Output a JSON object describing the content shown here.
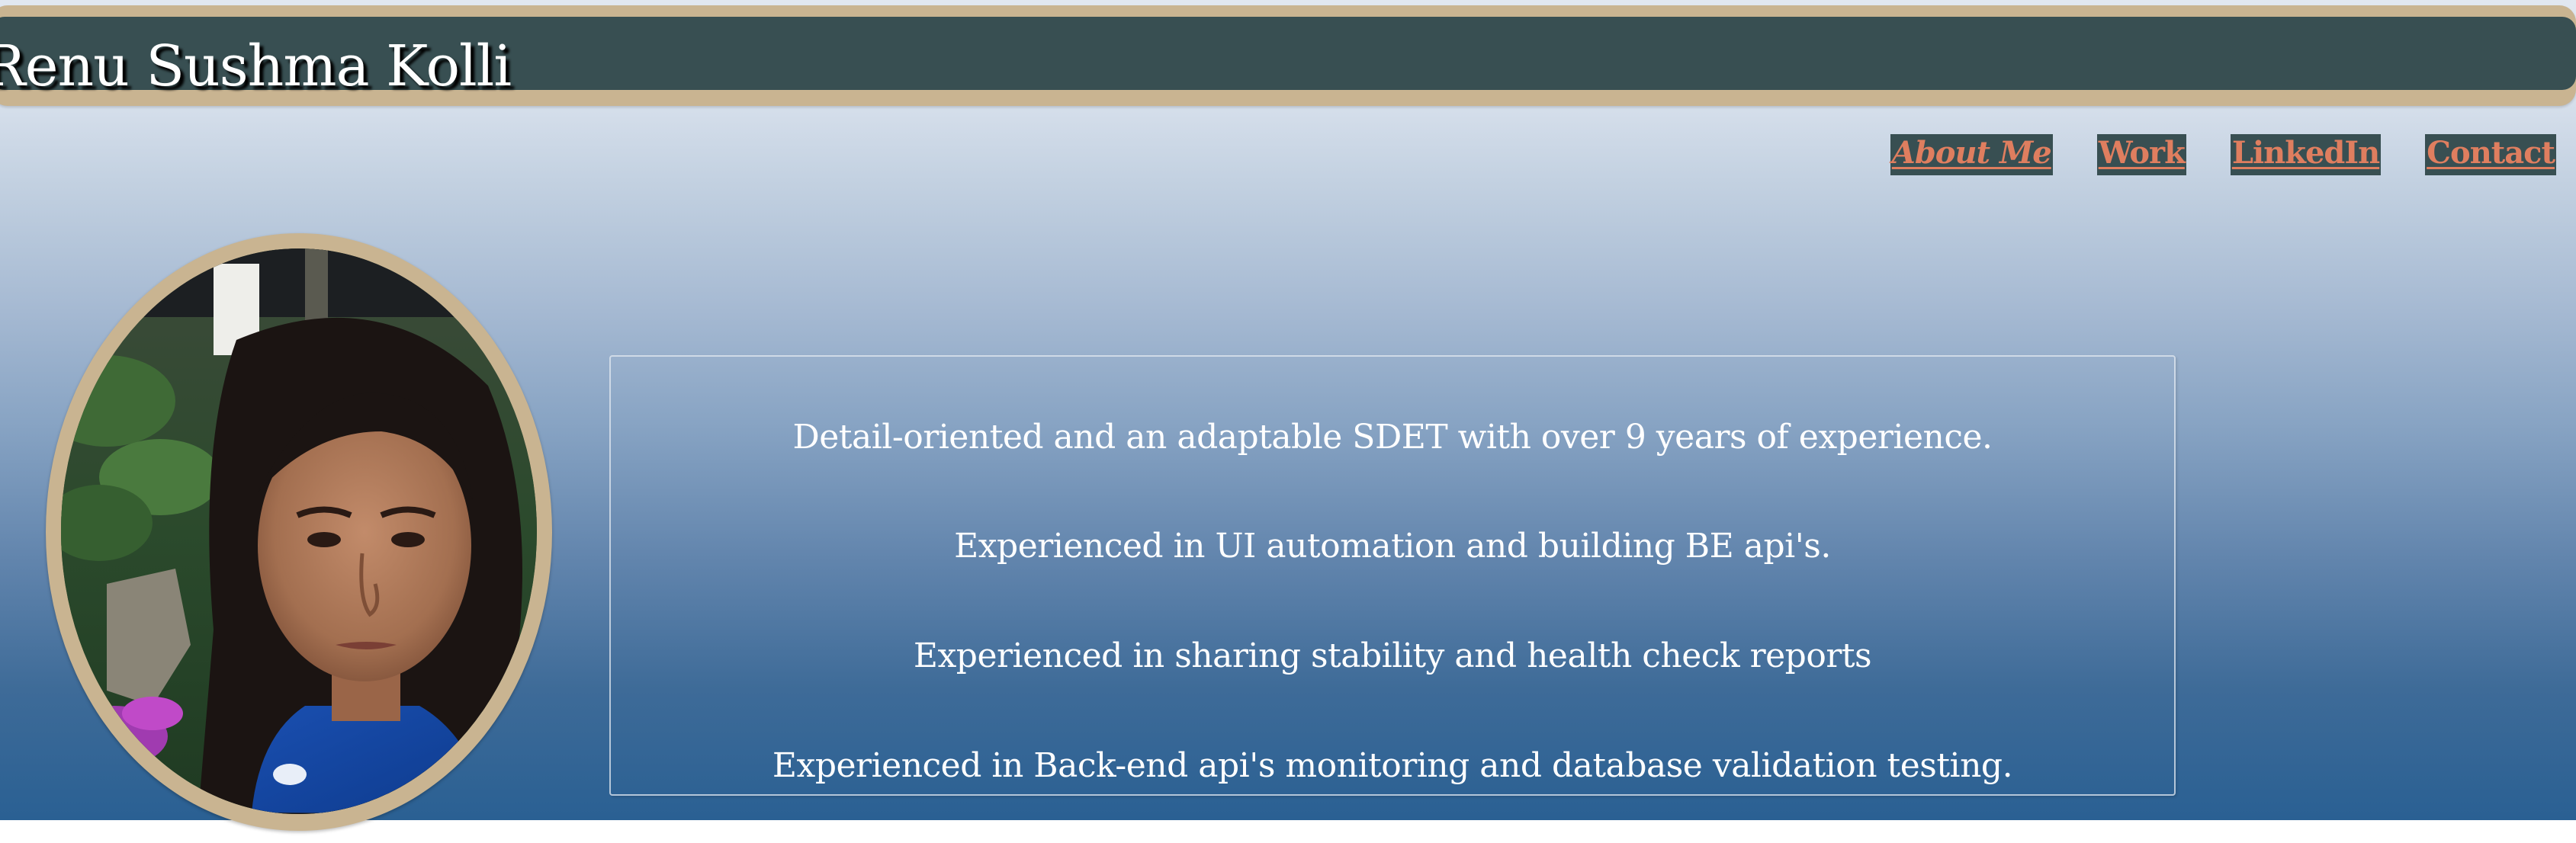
{
  "header": {
    "title": "Renu Sushma Kolli"
  },
  "nav": {
    "items": [
      {
        "label": "About Me",
        "style": "italic"
      },
      {
        "label": "Work"
      },
      {
        "label": "LinkedIn"
      },
      {
        "label": "Contact"
      }
    ]
  },
  "profile": {
    "photo_icon": "profile-photo"
  },
  "bio": {
    "lines": [
      "Detail-oriented and an adaptable SDET with over 9 years of experience.",
      "Experienced in UI automation and building BE api's.",
      "Experienced in sharing stability and health check reports",
      "Experienced in Back-end api's monitoring and database validation testing."
    ]
  },
  "colors": {
    "header_bg": "#384f52",
    "header_border": "#c9b491",
    "nav_link": "#df7e5f",
    "gradient_top": "#e1e7f0",
    "gradient_bottom": "#2a6093"
  }
}
